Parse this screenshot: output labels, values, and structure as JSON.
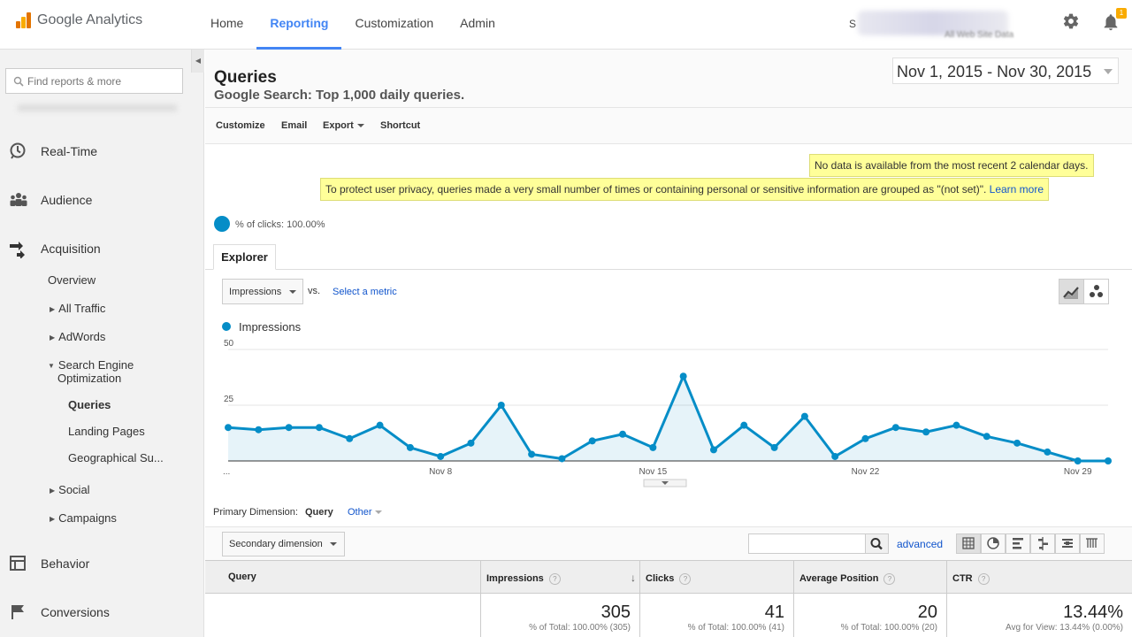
{
  "app": {
    "name": "Google Analytics"
  },
  "nav": {
    "items": [
      {
        "label": "Home"
      },
      {
        "label": "Reporting"
      },
      {
        "label": "Customization"
      },
      {
        "label": "Admin"
      }
    ]
  },
  "account": {
    "prefix": "S",
    "subtitle": "All Web Site Data",
    "notifications": "1"
  },
  "sidebar": {
    "search_placeholder": "Find reports & more",
    "items": {
      "realtime": "Real-Time",
      "audience": "Audience",
      "acquisition": "Acquisition",
      "behavior": "Behavior",
      "conversions": "Conversions"
    },
    "acq": {
      "overview": "Overview",
      "all_traffic": "All Traffic",
      "adwords": "AdWords",
      "seo_line1": "Search Engine",
      "seo_line2": "Optimization",
      "queries": "Queries",
      "landing_pages": "Landing Pages",
      "geo": "Geographical Su...",
      "social": "Social",
      "campaigns": "Campaigns"
    }
  },
  "page": {
    "title": "Queries",
    "subtitle": "Google Search: Top 1,000 daily queries.",
    "date_range": "Nov 1, 2015 - Nov 30, 2015"
  },
  "toolbar": {
    "customize": "Customize",
    "email": "Email",
    "export": "Export",
    "shortcut": "Shortcut"
  },
  "notices": {
    "no_data": "No data is available from the most recent 2 calendar days.",
    "privacy": "To protect user privacy, queries made a very small number of times or containing personal or sensitive information are grouped as \"(not set)\".",
    "learn_more": "Learn more"
  },
  "pct_clicks": "% of clicks: 100.00%",
  "explorer": {
    "tab": "Explorer",
    "metric": "Impressions",
    "vs": "vs.",
    "select_metric": "Select a metric"
  },
  "accent_color": "#058dc7",
  "chart_data": {
    "type": "area",
    "series": [
      {
        "name": "Impressions",
        "values": [
          15,
          14,
          15,
          15,
          10,
          16,
          6,
          2,
          8,
          25,
          3,
          1,
          9,
          12,
          6,
          38,
          5,
          16,
          6,
          20,
          2,
          10,
          15,
          13,
          16,
          11,
          8,
          4,
          0,
          0
        ]
      }
    ],
    "x": [
      "Nov 1",
      "Nov 2",
      "Nov 3",
      "Nov 4",
      "Nov 5",
      "Nov 6",
      "Nov 7",
      "Nov 8",
      "Nov 9",
      "Nov 10",
      "Nov 11",
      "Nov 12",
      "Nov 13",
      "Nov 14",
      "Nov 15",
      "Nov 16",
      "Nov 17",
      "Nov 18",
      "Nov 19",
      "Nov 20",
      "Nov 21",
      "Nov 22",
      "Nov 23",
      "Nov 24",
      "Nov 25",
      "Nov 26",
      "Nov 27",
      "Nov 28",
      "Nov 29",
      "Nov 30"
    ],
    "x_tick_labels": [
      "...",
      "Nov 8",
      "Nov 15",
      "Nov 22",
      "Nov 29"
    ],
    "y_ticks": [
      "25",
      "50"
    ],
    "ylim": [
      0,
      50
    ],
    "grid": true
  },
  "dimension": {
    "label": "Primary Dimension:",
    "value": "Query",
    "other": "Other"
  },
  "table": {
    "secondary_dimension": "Secondary dimension",
    "advanced": "advanced",
    "columns": [
      "Query",
      "Impressions",
      "Clicks",
      "Average Position",
      "CTR"
    ],
    "totals": [
      {
        "value": "305",
        "note": "% of Total: 100.00% (305)"
      },
      {
        "value": "41",
        "note": "% of Total: 100.00% (41)"
      },
      {
        "value": "20",
        "note": "% of Total: 100.00% (20)"
      },
      {
        "value": "13.44%",
        "note": "Avg for View: 13.44% (0.00%)"
      }
    ]
  }
}
